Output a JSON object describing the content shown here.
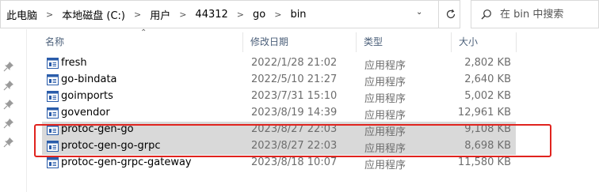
{
  "address": {
    "crumbs": [
      "此电脑",
      "本地磁盘 (C:)",
      "用户",
      "44312",
      "go",
      "bin"
    ]
  },
  "search": {
    "placeholder": "在 bin 中搜索"
  },
  "columns": {
    "name": "名称",
    "date": "修改日期",
    "type": "类型",
    "size": "大小"
  },
  "files": [
    {
      "name": "fresh",
      "date": "2022/1/28 21:02",
      "type": "应用程序",
      "size": "2,802 KB",
      "selected": false
    },
    {
      "name": "go-bindata",
      "date": "2022/5/10 21:27",
      "type": "应用程序",
      "size": "2,640 KB",
      "selected": false
    },
    {
      "name": "goimports",
      "date": "2023/7/31 15:10",
      "type": "应用程序",
      "size": "5,002 KB",
      "selected": false
    },
    {
      "name": "govendor",
      "date": "2023/8/19 14:39",
      "type": "应用程序",
      "size": "12,961 KB",
      "selected": false
    },
    {
      "name": "protoc-gen-go",
      "date": "2023/8/27 22:03",
      "type": "应用程序",
      "size": "9,108 KB",
      "selected": true
    },
    {
      "name": "protoc-gen-go-grpc",
      "date": "2023/8/27 22:03",
      "type": "应用程序",
      "size": "8,698 KB",
      "selected": true
    },
    {
      "name": "protoc-gen-grpc-gateway",
      "date": "2023/8/18 10:07",
      "type": "应用程序",
      "size": "11,580 KB",
      "selected": false
    }
  ],
  "colors": {
    "highlight_border": "#e0231e",
    "selection": "#d9d9d9",
    "icon_blue": "#1e64c8"
  },
  "icons": {
    "refresh": "refresh-icon",
    "search": "search-icon",
    "pin": "pin-icon",
    "file": "application-file-icon"
  }
}
